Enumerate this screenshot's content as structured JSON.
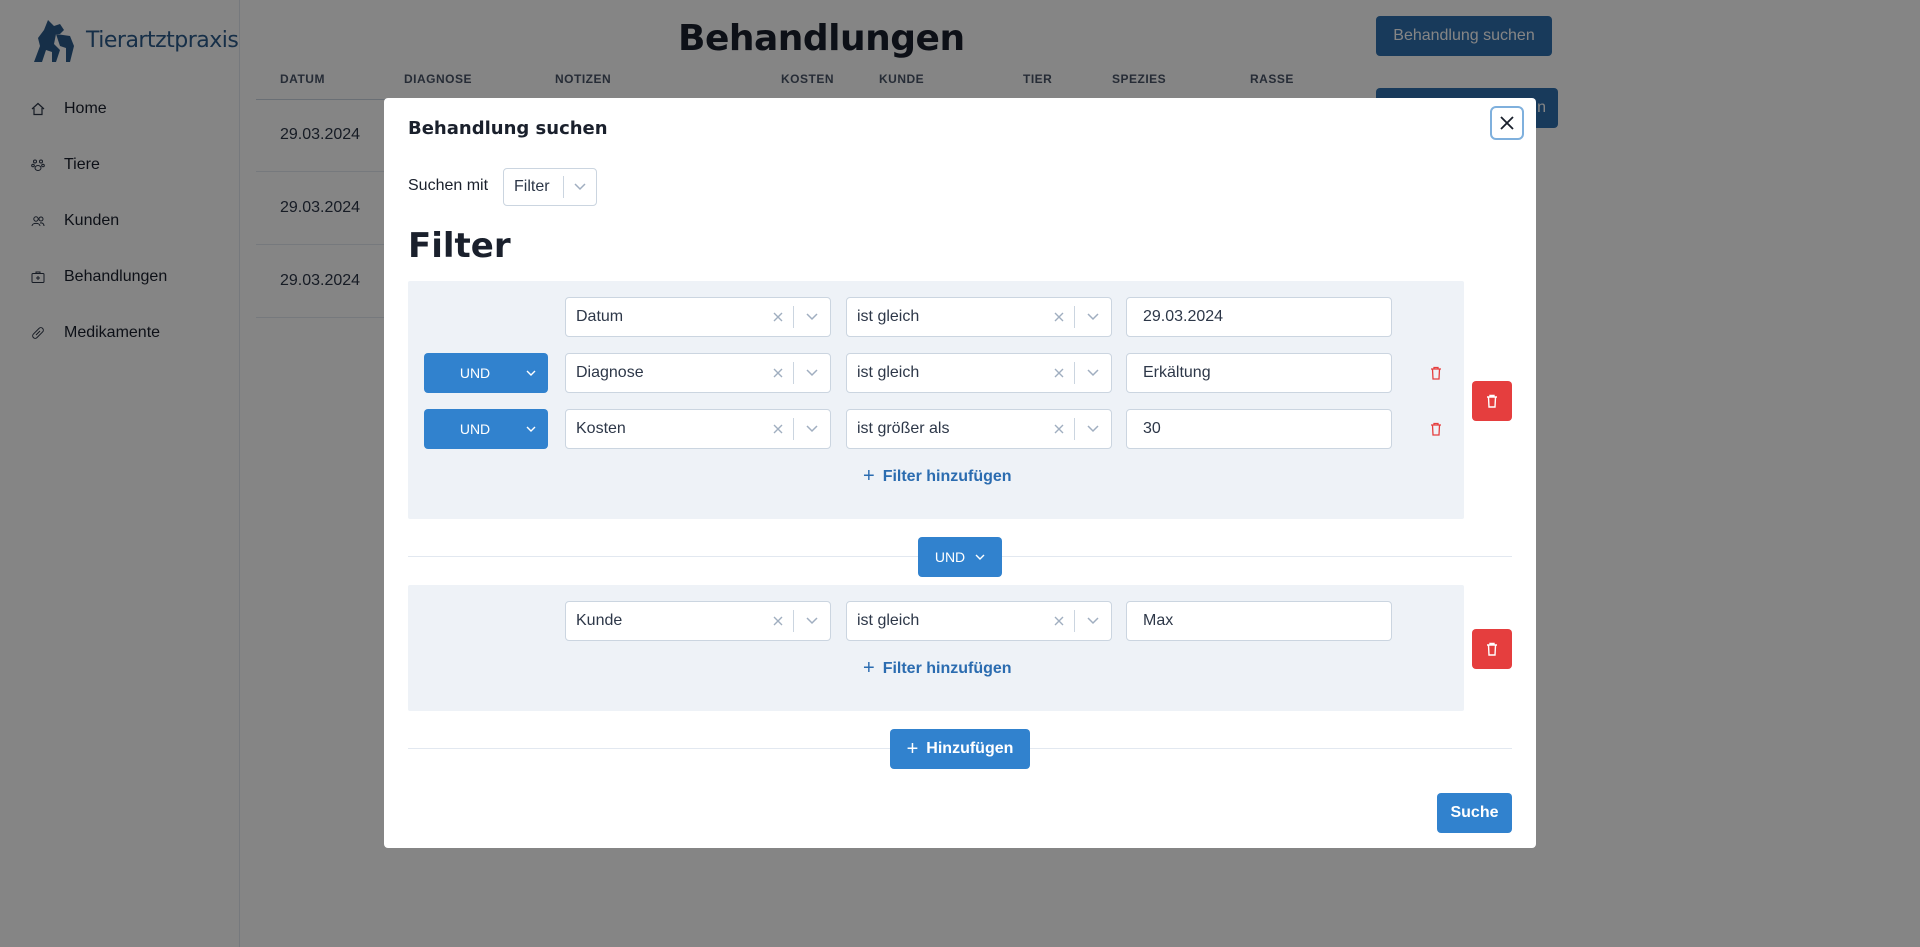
{
  "app": {
    "logo_text": "Tierartztpraxis"
  },
  "sidebar": {
    "items": [
      {
        "label": "Home",
        "icon": "home-icon"
      },
      {
        "label": "Tiere",
        "icon": "paw-icon"
      },
      {
        "label": "Kunden",
        "icon": "users-icon"
      },
      {
        "label": "Behandlungen",
        "icon": "medical-kit-icon"
      },
      {
        "label": "Medikamente",
        "icon": "pill-icon"
      }
    ]
  },
  "page": {
    "title": "Behandlungen",
    "search_button": "Behandlung suchen",
    "second_button_visible_text": "n"
  },
  "table": {
    "headers": [
      "DATUM",
      "DIAGNOSE",
      "NOTIZEN",
      "KOSTEN",
      "KUNDE",
      "TIER",
      "SPEZIES",
      "RASSE"
    ],
    "rows": [
      {
        "datum": "29.03.2024"
      },
      {
        "datum": "29.03.2024"
      },
      {
        "datum": "29.03.2024"
      }
    ]
  },
  "modal": {
    "title": "Behandlung suchen",
    "mode_label": "Suchen mit",
    "mode_value": "Filter",
    "filter_heading": "Filter",
    "groups": [
      {
        "filters": [
          {
            "connector": "",
            "field": "Datum",
            "operator": "ist gleich",
            "value": "29.03.2024"
          },
          {
            "connector": "UND",
            "field": "Diagnose",
            "operator": "ist gleich",
            "value": "Erkältung"
          },
          {
            "connector": "UND",
            "field": "Kosten",
            "operator": "ist größer als",
            "value": "30"
          }
        ],
        "add_filter_label": "Filter hinzufügen"
      },
      {
        "filters": [
          {
            "connector": "",
            "field": "Kunde",
            "operator": "ist gleich",
            "value": "Max"
          }
        ],
        "add_filter_label": "Filter hinzufügen"
      }
    ],
    "group_connector": "UND",
    "add_group_label": "Hinzufügen",
    "submit_label": "Suche"
  },
  "colors": {
    "primary": "#3182ce",
    "danger": "#e53e3e",
    "group_bg": "#eef2f7",
    "overlay": "rgba(0,0,0,0.48)"
  }
}
